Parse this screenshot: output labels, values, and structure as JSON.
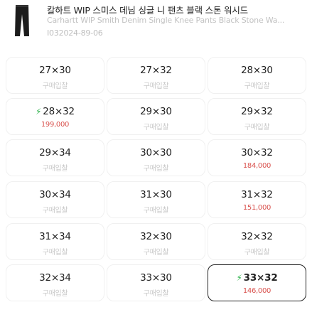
{
  "product": {
    "title": "칼하트 WIP 스미스 데님 싱글 니 팬츠 블랙 스톤 워시드",
    "subtitle": "Carhartt WIP Smith Denim Single Knee Pants Black Stone Wa...",
    "code": "I032024-89-06",
    "image_icon": "black-pants-thumbnail"
  },
  "colors": {
    "fast_bolt": "#2eb24c",
    "price_red": "#d9534f",
    "muted": "#c8c8c8",
    "selected_border": "#222222"
  },
  "sizes": [
    {
      "size": "27×30",
      "price": "구매입찰",
      "fast": false,
      "selected": false
    },
    {
      "size": "27×32",
      "price": "구매입찰",
      "fast": false,
      "selected": false
    },
    {
      "size": "28×30",
      "price": "구매입찰",
      "fast": false,
      "selected": false
    },
    {
      "size": "28×32",
      "price": "199,000",
      "fast": true,
      "selected": false
    },
    {
      "size": "29×30",
      "price": "구매입찰",
      "fast": false,
      "selected": false
    },
    {
      "size": "29×32",
      "price": "구매입찰",
      "fast": false,
      "selected": false
    },
    {
      "size": "29×34",
      "price": "구매입찰",
      "fast": false,
      "selected": false
    },
    {
      "size": "30×30",
      "price": "구매입찰",
      "fast": false,
      "selected": false
    },
    {
      "size": "30×32",
      "price": "184,000",
      "fast": false,
      "selected": false
    },
    {
      "size": "30×34",
      "price": "구매입찰",
      "fast": false,
      "selected": false
    },
    {
      "size": "31×30",
      "price": "구매입찰",
      "fast": false,
      "selected": false
    },
    {
      "size": "31×32",
      "price": "151,000",
      "fast": false,
      "selected": false
    },
    {
      "size": "31×34",
      "price": "구매입찰",
      "fast": false,
      "selected": false
    },
    {
      "size": "32×30",
      "price": "구매입찰",
      "fast": false,
      "selected": false
    },
    {
      "size": "32×32",
      "price": "구매입찰",
      "fast": false,
      "selected": false
    },
    {
      "size": "32×34",
      "price": "구매입찰",
      "fast": false,
      "selected": false
    },
    {
      "size": "33×30",
      "price": "구매입찰",
      "fast": false,
      "selected": false
    },
    {
      "size": "33×32",
      "price": "146,000",
      "fast": true,
      "selected": true
    }
  ]
}
